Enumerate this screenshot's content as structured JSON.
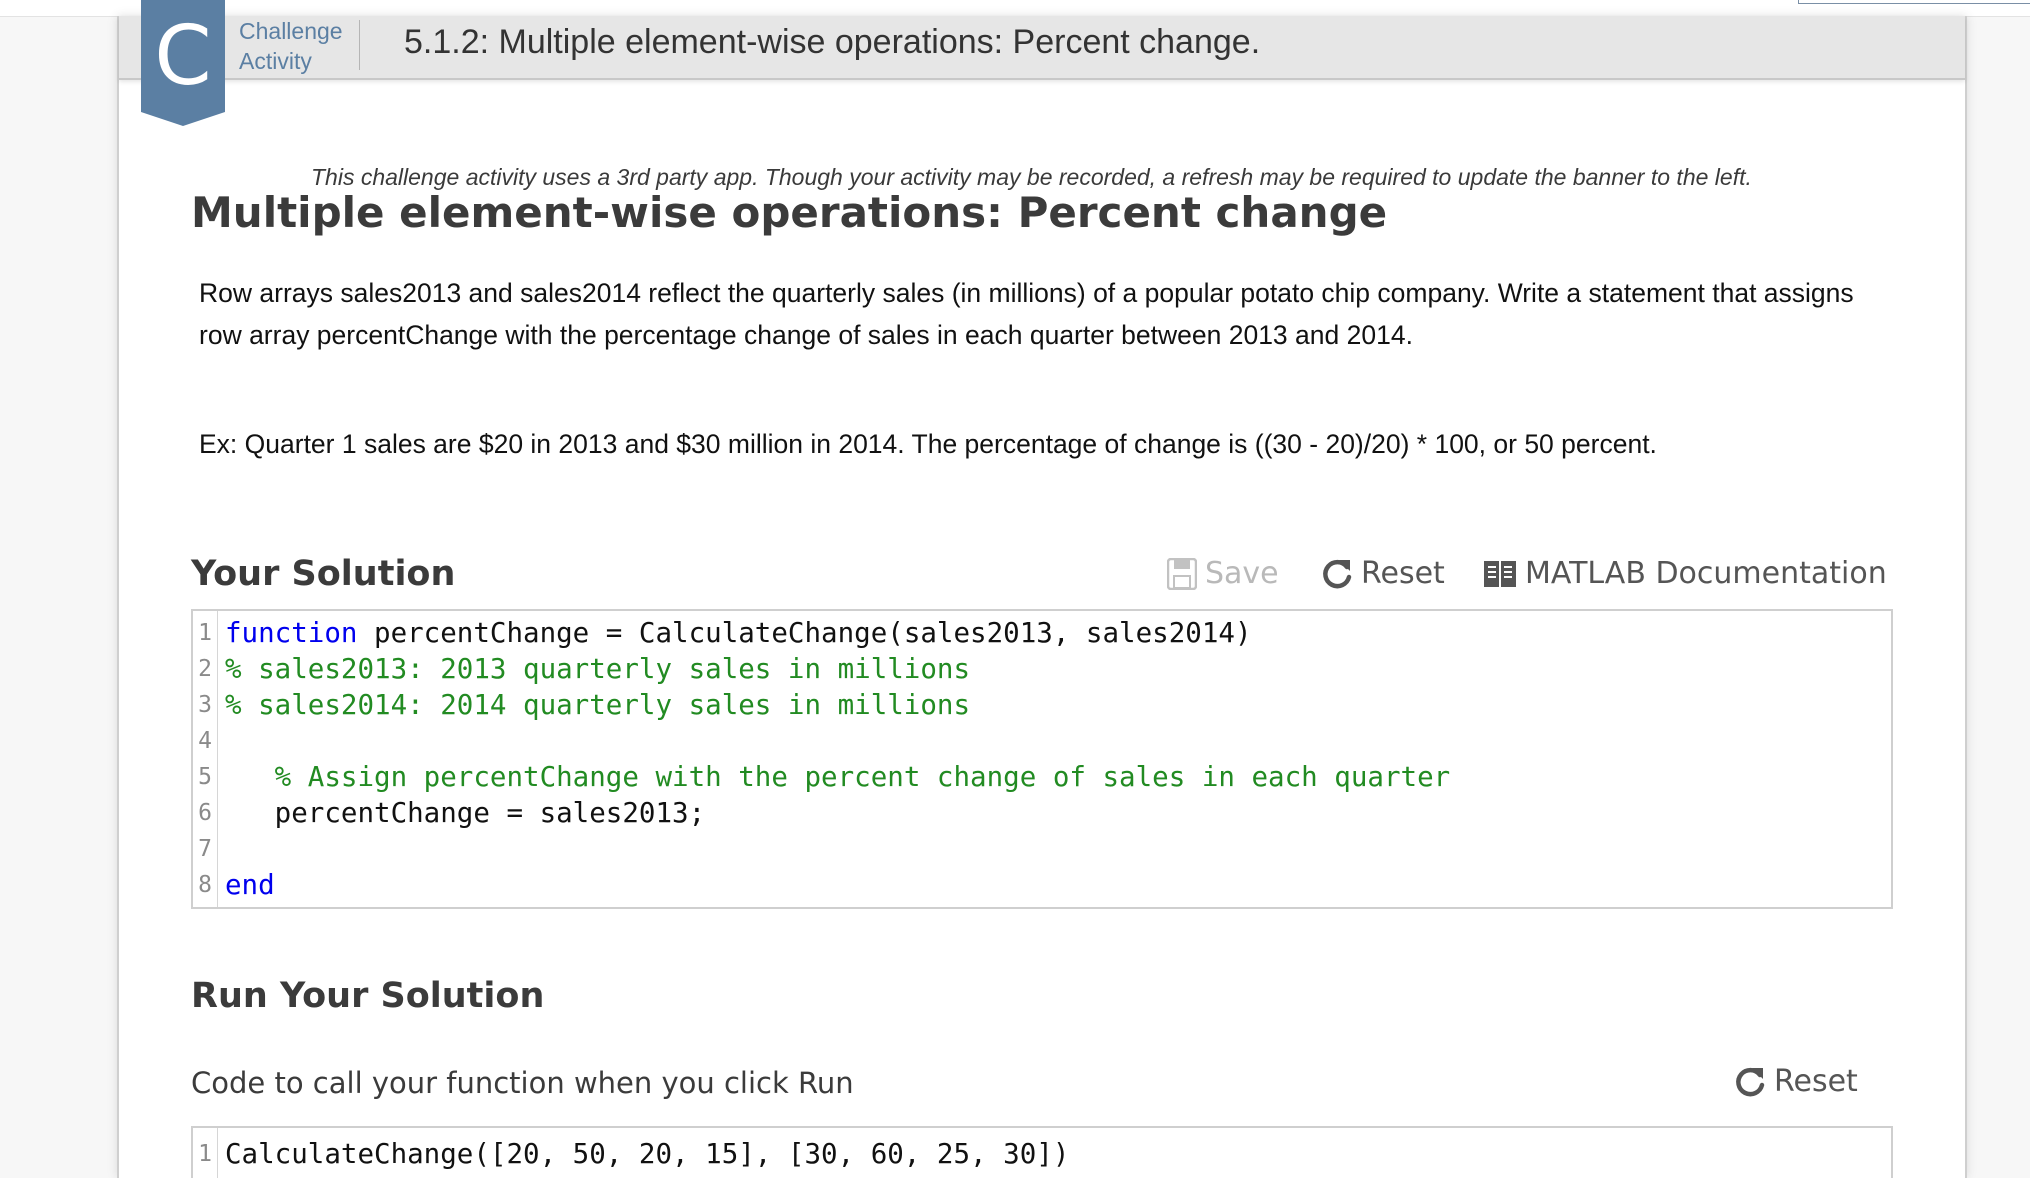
{
  "header": {
    "badge_letter": "C",
    "activity_type_line1": "Challenge",
    "activity_type_line2": "Activity",
    "title": "5.1.2: Multiple element-wise operations: Percent change."
  },
  "notice": "This challenge activity uses a 3rd party app. Though your activity may be recorded, a refresh may be required to update the banner to the left.",
  "main_title": "Multiple element-wise operations: Percent change",
  "prompt": "Row arrays sales2013 and sales2014 reflect the quarterly sales (in millions) of a popular potato chip company. Write a statement that assigns row array percentChange with the percentage change of sales in each quarter between 2013 and 2014.",
  "example": "Ex: Quarter 1 sales are $20 in 2013 and $30 million in 2014. The percentage of change is ((30 - 20)/20) * 100, or 50 percent.",
  "solution": {
    "title": "Your Solution",
    "save_label": "Save",
    "reset_label": "Reset",
    "docs_label": "MATLAB Documentation",
    "lines": [
      {
        "n": "1",
        "kw": "function",
        "text": " percentChange = CalculateChange(sales2013, sales2014)",
        "comment": ""
      },
      {
        "n": "2",
        "kw": "",
        "text": "",
        "comment": "% sales2013: 2013 quarterly sales in millions"
      },
      {
        "n": "3",
        "kw": "",
        "text": "",
        "comment": "% sales2014: 2014 quarterly sales in millions"
      },
      {
        "n": "4",
        "kw": "",
        "text": "",
        "comment": ""
      },
      {
        "n": "5",
        "kw": "",
        "text": "   ",
        "comment": "% Assign percentChange with the percent change of sales in each quarter"
      },
      {
        "n": "6",
        "kw": "",
        "text": "   percentChange = sales2013;",
        "comment": ""
      },
      {
        "n": "7",
        "kw": "",
        "text": "",
        "comment": ""
      },
      {
        "n": "8",
        "kw": "end",
        "text": "",
        "comment": ""
      }
    ]
  },
  "run": {
    "title": "Run Your Solution",
    "subtitle": "Code to call your function when you click Run",
    "reset_label": "Reset",
    "lines": [
      {
        "n": "1",
        "kw": "",
        "text": "CalculateChange([20, 50, 20, 15], [30, 60, 25, 30])",
        "comment": ""
      }
    ]
  },
  "colors": {
    "badge": "#5b7fa3",
    "keyword": "#0000ee",
    "comment": "#228b22"
  }
}
